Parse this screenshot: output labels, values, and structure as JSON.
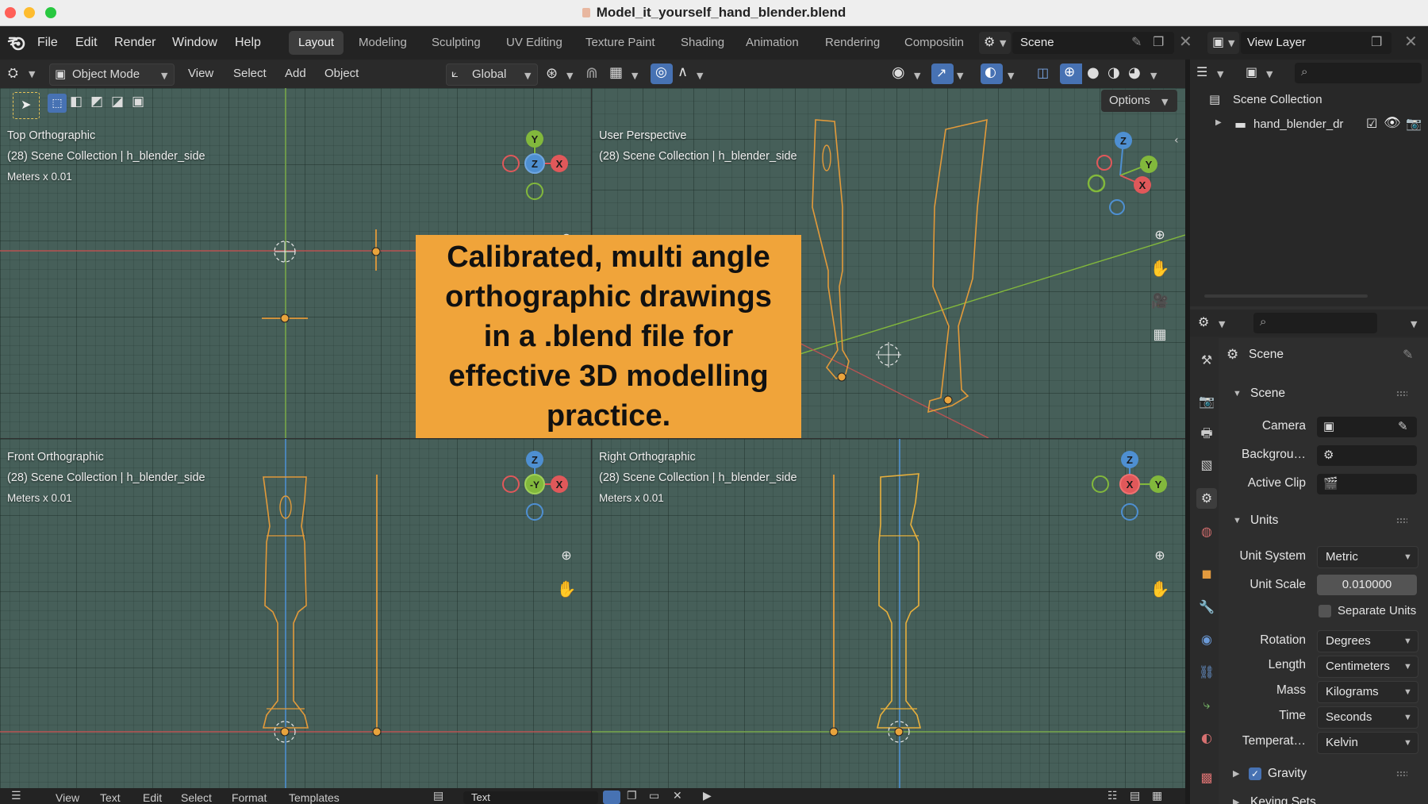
{
  "window": {
    "title": "Model_it_yourself_hand_blender.blend",
    "traffic_colors": [
      "#ff5f57",
      "#febc2e",
      "#28c840"
    ]
  },
  "topmenu": {
    "items": [
      "File",
      "Edit",
      "Render",
      "Window",
      "Help"
    ],
    "workspaces": [
      "Layout",
      "Modeling",
      "Sculpting",
      "UV Editing",
      "Texture Paint",
      "Shading",
      "Animation",
      "Rendering",
      "Compositin"
    ],
    "active_workspace": "Layout",
    "scene_name": "Scene",
    "view_layer": "View Layer"
  },
  "viewport_header": {
    "mode": "Object Mode",
    "menus": [
      "View",
      "Select",
      "Add",
      "Object"
    ],
    "transform_orientation": "Global",
    "options_label": "Options"
  },
  "viewports": {
    "top": {
      "title": "Top Orthographic",
      "collection": "(28) Scene Collection | h_blender_side",
      "units": "Meters x 0.01",
      "gizmo": [
        "Y",
        "Z",
        "X"
      ]
    },
    "persp": {
      "title": "User Perspective",
      "collection": "(28) Scene Collection | h_blender_side",
      "gizmo": [
        "Z",
        "Y",
        "X"
      ]
    },
    "front": {
      "title": "Front Orthographic",
      "collection": "(28) Scene Collection | h_blender_side",
      "units": "Meters x 0.01",
      "gizmo": [
        "Z",
        "-Y",
        "X"
      ]
    },
    "right": {
      "title": "Right Orthographic",
      "collection": "(28) Scene Collection | h_blender_side",
      "units": "Meters x 0.01",
      "gizmo": [
        "Z",
        "X",
        "Y"
      ]
    }
  },
  "banner": {
    "lines": [
      "Calibrated, multi angle",
      "orthographic drawings",
      "in a .blend file for",
      "effective 3D modelling",
      "practice."
    ],
    "color": "#f0a43a"
  },
  "outliner": {
    "root": "Scene Collection",
    "items": [
      "hand_blender_dr"
    ]
  },
  "properties": {
    "context": "Scene",
    "scene_panel": {
      "header": "Scene",
      "camera_label": "Camera",
      "background_label": "Backgrou…",
      "active_clip_label": "Active Clip"
    },
    "units_panel": {
      "header": "Units",
      "unit_system_label": "Unit System",
      "unit_system": "Metric",
      "unit_scale_label": "Unit Scale",
      "unit_scale": "0.010000",
      "separate_units": "Separate Units",
      "rotation_label": "Rotation",
      "rotation": "Degrees",
      "length_label": "Length",
      "length": "Centimeters",
      "mass_label": "Mass",
      "mass": "Kilograms",
      "time_label": "Time",
      "time": "Seconds",
      "temperature_label": "Temperat…",
      "temperature": "Kelvin"
    },
    "gravity_label": "Gravity",
    "next_panel": "Keying Sets"
  },
  "bottombar": {
    "items": [
      "View",
      "Text",
      "Edit",
      "Select",
      "Format",
      "Templates"
    ],
    "text_name": "Text"
  },
  "colors": {
    "accent_blue": "#4772b3",
    "x_axis": "#e0585a",
    "y_axis": "#82b83c",
    "z_axis": "#4e8fd1",
    "outline_orange": "#e29a3a"
  }
}
